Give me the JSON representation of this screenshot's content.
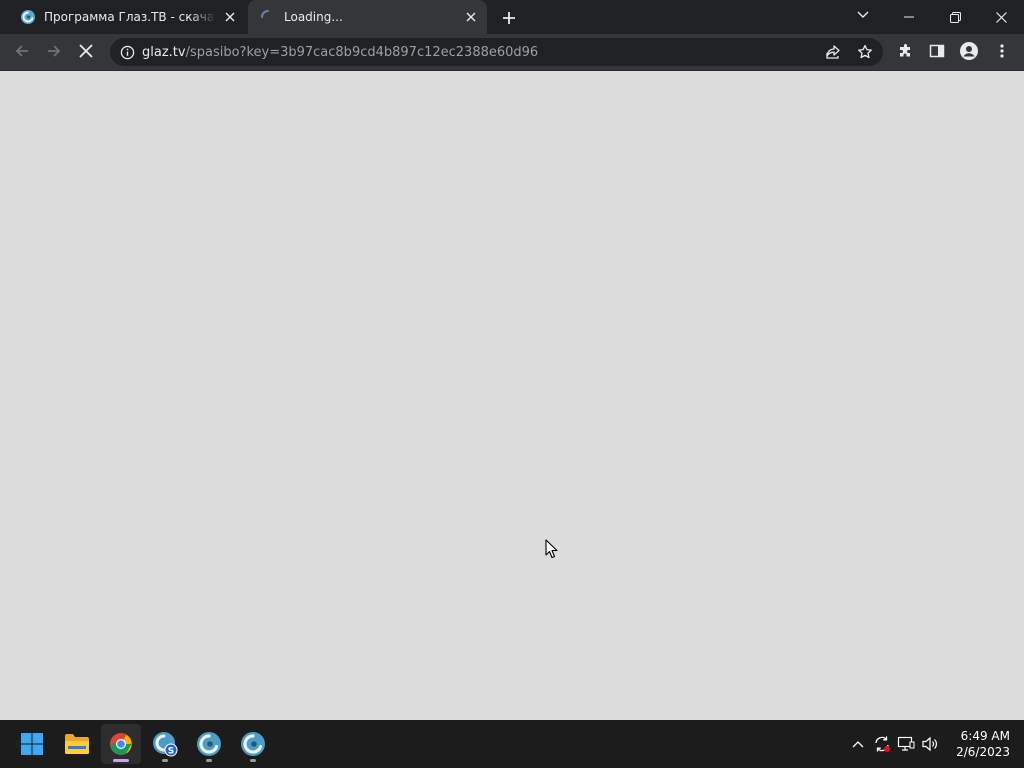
{
  "browser": {
    "tabs": [
      {
        "title": "Программа Глаз.ТВ - скачать и смотреть",
        "icon": "glaz-tv-favicon",
        "active": false
      },
      {
        "title": "Loading...",
        "icon": "loading-spinner-icon",
        "active": true
      }
    ],
    "address_bar": {
      "host": "glaz.tv",
      "path": "/spasibo?key=3b97cac8b9cd4b897c12ec2388e60d96"
    }
  },
  "taskbar": {
    "apps": [
      {
        "name": "start",
        "icon": "windows-start-icon"
      },
      {
        "name": "file-explorer",
        "icon": "folder-icon"
      },
      {
        "name": "chrome",
        "icon": "chrome-icon",
        "active": true
      },
      {
        "name": "glaz-tv-setup",
        "icon": "glaz-setup-icon"
      },
      {
        "name": "glaz-tv-1",
        "icon": "glaz-tv-icon"
      },
      {
        "name": "glaz-tv-2",
        "icon": "glaz-tv-icon"
      }
    ],
    "clock": {
      "time": "6:49 AM",
      "date": "2/6/2023"
    }
  },
  "colors": {
    "titlebar": "#202124",
    "toolbar": "#35363a",
    "page_bg": "#dcdcdc",
    "taskbar": "#1c1c1c",
    "accent_chrome_indicator": "#c7a6e8"
  }
}
